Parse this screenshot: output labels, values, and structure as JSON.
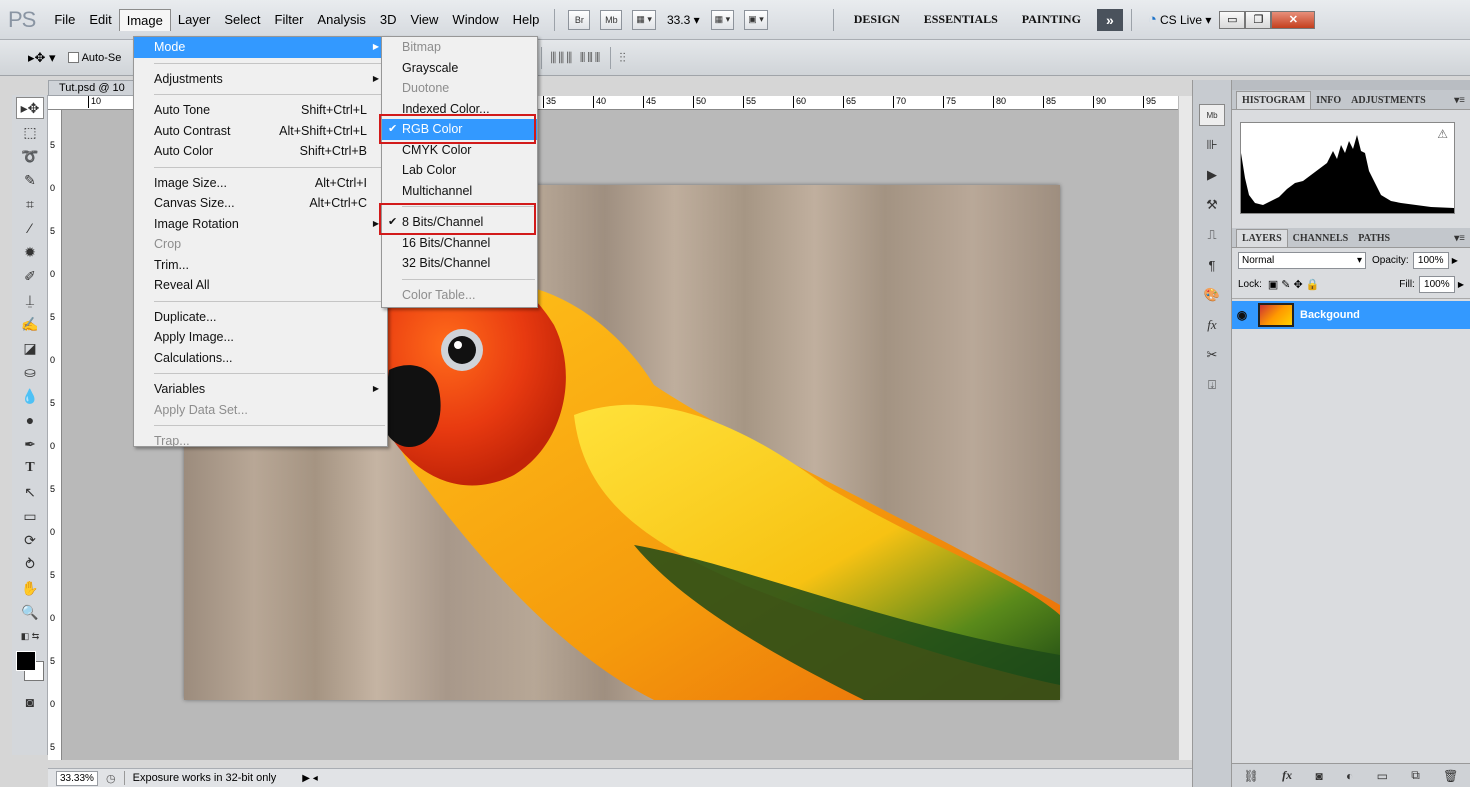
{
  "app": {
    "logo": "PS"
  },
  "menubar": {
    "items": [
      "File",
      "Edit",
      "Image",
      "Layer",
      "Select",
      "Filter",
      "Analysis",
      "3D",
      "View",
      "Window",
      "Help"
    ],
    "active_index": 2,
    "bridge": "Br",
    "minibridge": "Mb",
    "zoom": "33.3",
    "workspaces": [
      "DESIGN",
      "ESSENTIALS",
      "PAINTING"
    ],
    "more": "»",
    "cslive": "CS Live"
  },
  "optbar": {
    "auto_select": "Auto-Se"
  },
  "document": {
    "tab_title": "Tut.psd @ 10",
    "ruler_top": [
      "10",
      "35",
      "40",
      "45",
      "50",
      "55",
      "60",
      "65",
      "70",
      "75",
      "80",
      "85",
      "90",
      "95"
    ],
    "ruler_left": [
      "5",
      "0",
      "5",
      "0",
      "5",
      "0",
      "5",
      "0",
      "5",
      "0",
      "5",
      "0",
      "5",
      "0",
      "5"
    ]
  },
  "status": {
    "zoom": "33.33%",
    "message": "Exposure works in 32-bit only"
  },
  "image_menu": {
    "items": [
      {
        "label": "Mode",
        "submenu": true,
        "highlighted": true
      },
      {
        "sep": true
      },
      {
        "label": "Adjustments",
        "submenu": true
      },
      {
        "sep": true
      },
      {
        "label": "Auto Tone",
        "shortcut": "Shift+Ctrl+L"
      },
      {
        "label": "Auto Contrast",
        "shortcut": "Alt+Shift+Ctrl+L"
      },
      {
        "label": "Auto Color",
        "shortcut": "Shift+Ctrl+B"
      },
      {
        "sep": true
      },
      {
        "label": "Image Size...",
        "shortcut": "Alt+Ctrl+I"
      },
      {
        "label": "Canvas Size...",
        "shortcut": "Alt+Ctrl+C"
      },
      {
        "label": "Image Rotation",
        "submenu": true
      },
      {
        "label": "Crop",
        "disabled": true
      },
      {
        "label": "Trim..."
      },
      {
        "label": "Reveal All"
      },
      {
        "sep": true
      },
      {
        "label": "Duplicate..."
      },
      {
        "label": "Apply Image..."
      },
      {
        "label": "Calculations..."
      },
      {
        "sep": true
      },
      {
        "label": "Variables",
        "submenu": true
      },
      {
        "label": "Apply Data Set...",
        "disabled": true
      },
      {
        "sep": true
      },
      {
        "label": "Trap...",
        "disabled": true
      }
    ]
  },
  "mode_menu": {
    "items": [
      {
        "label": "Bitmap",
        "disabled": true
      },
      {
        "label": "Grayscale"
      },
      {
        "label": "Duotone",
        "disabled": true
      },
      {
        "label": "Indexed Color..."
      },
      {
        "label": "RGB Color",
        "checked": true,
        "highlighted": true
      },
      {
        "label": "CMYK Color"
      },
      {
        "label": "Lab Color"
      },
      {
        "label": "Multichannel"
      },
      {
        "sep": true
      },
      {
        "label": "8 Bits/Channel",
        "checked": true
      },
      {
        "label": "16 Bits/Channel"
      },
      {
        "label": "32 Bits/Channel"
      },
      {
        "sep": true
      },
      {
        "label": "Color Table...",
        "disabled": true
      }
    ]
  },
  "panels": {
    "top_tabs": [
      "HISTOGRAM",
      "INFO",
      "ADJUSTMENTS"
    ],
    "layer_tabs": [
      "LAYERS",
      "CHANNELS",
      "PATHS"
    ],
    "blend_mode": "Normal",
    "opacity_label": "Opacity:",
    "opacity_value": "100%",
    "lock_label": "Lock:",
    "fill_label": "Fill:",
    "fill_value": "100%",
    "layer_name": "Backgound"
  },
  "dock": {
    "mb": "Mb"
  },
  "colors": {
    "highlight": "#3399ff",
    "annotation": "#d21a1a"
  }
}
